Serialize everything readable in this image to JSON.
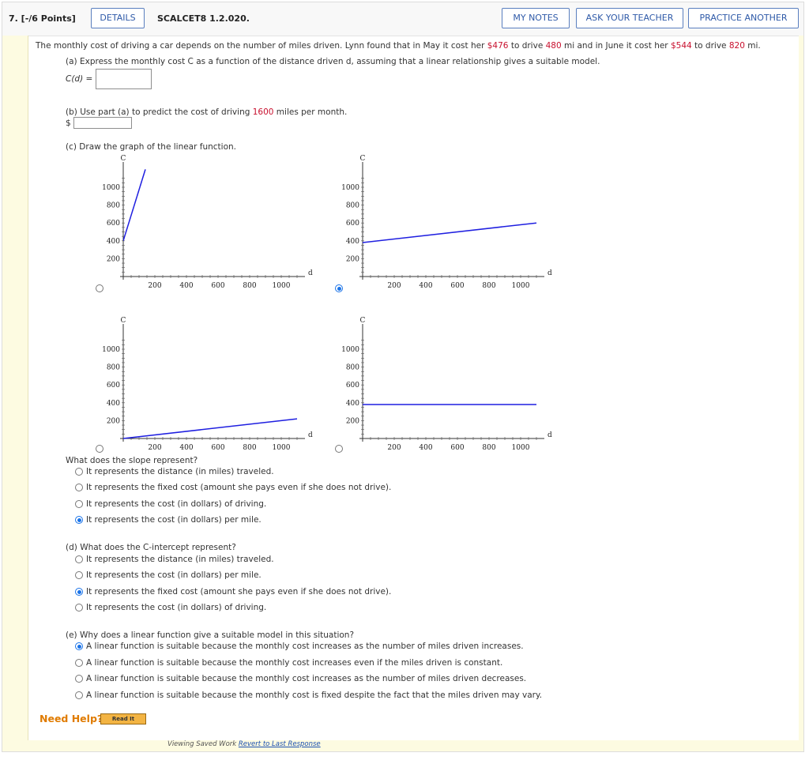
{
  "header": {
    "number": "7. [-/6 Points]",
    "details": "DETAILS",
    "code": "SCALCET8 1.2.020.",
    "my_notes": "MY NOTES",
    "ask_teacher": "ASK YOUR TEACHER",
    "practice": "PRACTICE ANOTHER"
  },
  "problem": {
    "pre": "The monthly cost of driving a car depends on the number of miles driven. Lynn found that in May it cost her ",
    "cost1": "$476",
    "mid1": " to drive ",
    "miles1": "480",
    "mid2": " mi and in June it cost her ",
    "cost2": "$544",
    "mid3": " to drive ",
    "miles2": "820",
    "end": " mi."
  },
  "part_a": {
    "prompt": "(a) Express the monthly cost C as a function of the distance driven d, assuming that a linear relationship gives a suitable model.",
    "label": "C(d) =",
    "value": ""
  },
  "part_b": {
    "pre": "(b) Use part (a) to predict the cost of driving ",
    "miles": "1600",
    "post": " miles per month.",
    "dollar": "$",
    "value": ""
  },
  "part_c": {
    "prompt": "(c) Draw the graph of the linear function.",
    "slope_q": "What does the slope represent?",
    "slope_options": [
      "It represents the distance (in miles) traveled.",
      "It represents the fixed cost (amount she pays even if she does not drive).",
      "It represents the cost (in dollars) of driving.",
      "It represents the cost (in dollars) per mile."
    ],
    "slope_selected": 3,
    "graph_selected": 1
  },
  "part_d": {
    "prompt": "(d) What does the C-intercept represent?",
    "options": [
      "It represents the distance (in miles) traveled.",
      "It represents the cost (in dollars) per mile.",
      "It represents the fixed cost (amount she pays even if she does not drive).",
      "It represents the cost (in dollars) of driving."
    ],
    "selected": 2
  },
  "part_e": {
    "prompt": "(e) Why does a linear function give a suitable model in this situation?",
    "options": [
      "A linear function is suitable because the monthly cost increases as the number of miles driven increases.",
      "A linear function is suitable because the monthly cost increases even if the miles driven is constant.",
      "A linear function is suitable because the monthly cost increases as the number of miles driven decreases.",
      "A linear function is suitable because the monthly cost is fixed despite the fact that the miles driven may vary."
    ],
    "selected": 0
  },
  "help": {
    "need_help": "Need Help?",
    "read_it": "Read It"
  },
  "footer": {
    "viewing": "Viewing Saved Work ",
    "revert": "Revert to Last Response"
  },
  "chart_data": [
    {
      "type": "line",
      "xlabel": "d",
      "ylabel": "C",
      "xlim": [
        0,
        1150
      ],
      "ylim": [
        0,
        1100
      ],
      "xticks": [
        "200",
        "400",
        "600",
        "800",
        "1000"
      ],
      "yticks": [
        "200",
        "400",
        "600",
        "800",
        "1000"
      ],
      "x": [
        0,
        140
      ],
      "y": [
        400,
        1200
      ]
    },
    {
      "type": "line",
      "xlabel": "d",
      "ylabel": "C",
      "xlim": [
        0,
        1150
      ],
      "ylim": [
        0,
        1100
      ],
      "xticks": [
        "200",
        "400",
        "600",
        "800",
        "1000"
      ],
      "yticks": [
        "200",
        "400",
        "600",
        "800",
        "1000"
      ],
      "x": [
        0,
        1100
      ],
      "y": [
        380,
        600
      ]
    },
    {
      "type": "line",
      "xlabel": "d",
      "ylabel": "C",
      "xlim": [
        0,
        1150
      ],
      "ylim": [
        0,
        1100
      ],
      "xticks": [
        "200",
        "400",
        "600",
        "800",
        "1000"
      ],
      "yticks": [
        "200",
        "400",
        "600",
        "800",
        "1000"
      ],
      "x": [
        0,
        1100
      ],
      "y": [
        0,
        220
      ]
    },
    {
      "type": "line",
      "xlabel": "d",
      "ylabel": "C",
      "xlim": [
        0,
        1150
      ],
      "ylim": [
        0,
        1100
      ],
      "xticks": [
        "200",
        "400",
        "600",
        "800",
        "1000"
      ],
      "yticks": [
        "200",
        "400",
        "600",
        "800",
        "1000"
      ],
      "x": [
        0,
        1100
      ],
      "y": [
        380,
        380
      ]
    }
  ]
}
